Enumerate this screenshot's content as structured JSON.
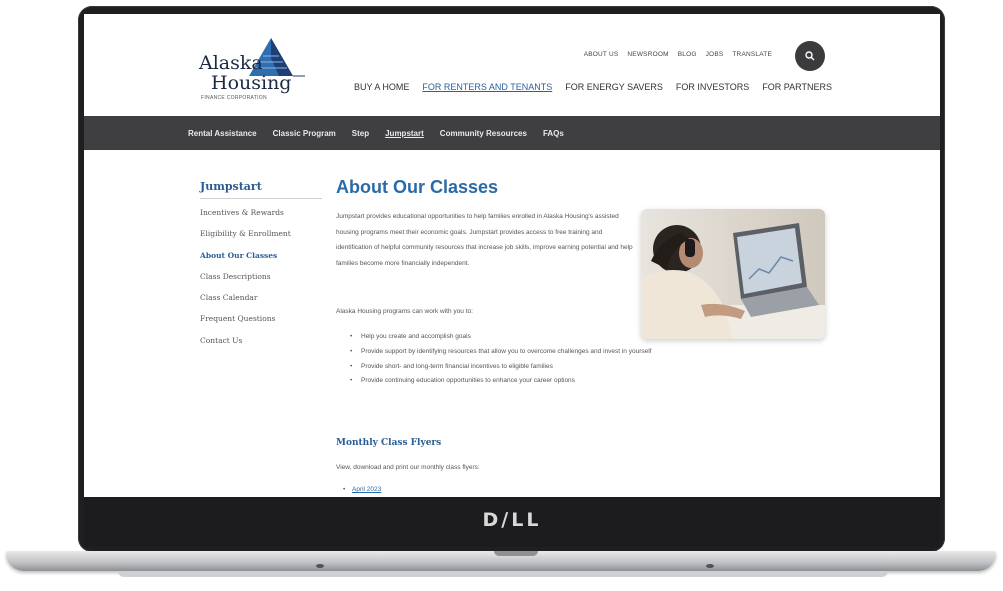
{
  "device": {
    "brand_logo": "D∕LL"
  },
  "site": {
    "logo": {
      "line1": "Alaska",
      "line2": "Housing",
      "sub": "FINANCE CORPORATION"
    },
    "utility_nav": [
      "ABOUT US",
      "NEWSROOM",
      "BLOG",
      "JOBS",
      "TRANSLATE"
    ],
    "main_nav": [
      "BUY A HOME",
      "FOR RENTERS AND TENANTS",
      "FOR ENERGY SAVERS",
      "FOR INVESTORS",
      "FOR PARTNERS"
    ],
    "main_nav_active": "FOR RENTERS AND TENANTS",
    "sub_nav": [
      "Rental Assistance",
      "Classic Program",
      "Step",
      "Jumpstart",
      "Community Resources",
      "FAQs"
    ],
    "sub_nav_active": "Jumpstart",
    "search_icon": "search-icon"
  },
  "sidebar": {
    "title": "Jumpstart",
    "items": [
      "Incentives & Rewards",
      "Eligibility & Enrollment",
      "About Our Classes",
      "Class Descriptions",
      "Class Calendar",
      "Frequent Questions",
      "Contact Us"
    ],
    "current": "About Our Classes"
  },
  "content": {
    "title": "About Our Classes",
    "intro": "Jumpstart provides educational opportunities to help families enrolled in Alaska Housing's assisted housing programs meet their economic goals. Jumpstart provides access to free training and identification of helpful community resources that increase job skills, improve earning potential and help families become more financially independent.",
    "lead": "Alaska Housing programs can work with you to:",
    "bullets": [
      "Help you create and accomplish goals",
      "Provide support by identifying resources that allow you to overcome challenges and invest in yourself",
      "Provide short- and long-term financial incentives to eligible families",
      "Provide continuing education opportunities to enhance your career options"
    ],
    "flyers_title": "Monthly Class Flyers",
    "flyers_text": "View, download and print our monthly class flyers:",
    "flyer_items": [
      "April 2023"
    ]
  },
  "colors": {
    "accent": "#2a6aa6",
    "subnav_bg": "#3f3f41",
    "bezel": "#1f1f21"
  }
}
